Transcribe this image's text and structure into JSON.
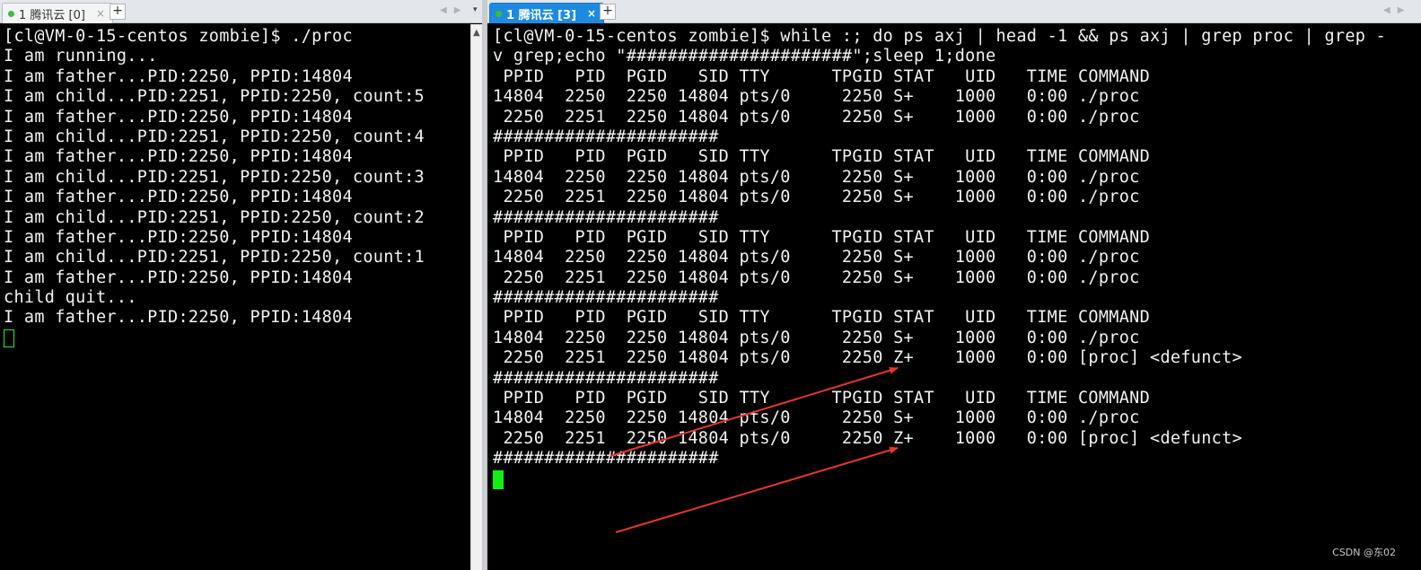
{
  "left_tab": {
    "label": "1 腾讯云 [0]",
    "close": "×",
    "new_tab": "+"
  },
  "right_tab": {
    "label": "1 腾讯云 [3]",
    "close": "×",
    "new_tab": "+"
  },
  "nav": {
    "arrows": "◀▶",
    "menu": "▾"
  },
  "left_terminal": {
    "lines": [
      "[cl@VM-0-15-centos zombie]$ ./proc",
      "I am running...",
      "I am father...PID:2250, PPID:14804",
      "I am child...PID:2251, PPID:2250, count:5",
      "I am father...PID:2250, PPID:14804",
      "I am child...PID:2251, PPID:2250, count:4",
      "I am father...PID:2250, PPID:14804",
      "I am child...PID:2251, PPID:2250, count:3",
      "I am father...PID:2250, PPID:14804",
      "I am child...PID:2251, PPID:2250, count:2",
      "I am father...PID:2250, PPID:14804",
      "I am child...PID:2251, PPID:2250, count:1",
      "I am father...PID:2250, PPID:14804",
      "child quit...",
      "I am father...PID:2250, PPID:14804"
    ]
  },
  "right_terminal": {
    "lines": [
      "[cl@VM-0-15-centos zombie]$ while :; do ps axj | head -1 && ps axj | grep proc | grep -",
      "v grep;echo \"######################\";sleep 1;done",
      " PPID   PID  PGID   SID TTY      TPGID STAT   UID   TIME COMMAND",
      "14804  2250  2250 14804 pts/0     2250 S+    1000   0:00 ./proc",
      " 2250  2251  2250 14804 pts/0     2250 S+    1000   0:00 ./proc",
      "######################",
      " PPID   PID  PGID   SID TTY      TPGID STAT   UID   TIME COMMAND",
      "14804  2250  2250 14804 pts/0     2250 S+    1000   0:00 ./proc",
      " 2250  2251  2250 14804 pts/0     2250 S+    1000   0:00 ./proc",
      "######################",
      " PPID   PID  PGID   SID TTY      TPGID STAT   UID   TIME COMMAND",
      "14804  2250  2250 14804 pts/0     2250 S+    1000   0:00 ./proc",
      " 2250  2251  2250 14804 pts/0     2250 S+    1000   0:00 ./proc",
      "######################",
      " PPID   PID  PGID   SID TTY      TPGID STAT   UID   TIME COMMAND",
      "14804  2250  2250 14804 pts/0     2250 S+    1000   0:00 ./proc",
      " 2250  2251  2250 14804 pts/0     2250 Z+    1000   0:00 [proc] <defunct>",
      "######################",
      " PPID   PID  PGID   SID TTY      TPGID STAT   UID   TIME COMMAND",
      "14804  2250  2250 14804 pts/0     2250 S+    1000   0:00 ./proc",
      " 2250  2251  2250 14804 pts/0     2250 Z+    1000   0:00 [proc] <defunct>",
      "######################"
    ]
  },
  "colors": {
    "annotation_arrow": "#e8352b",
    "cursor": "#10f010",
    "active_tab": "#1e8be0"
  },
  "watermark": "CSDN @东02"
}
